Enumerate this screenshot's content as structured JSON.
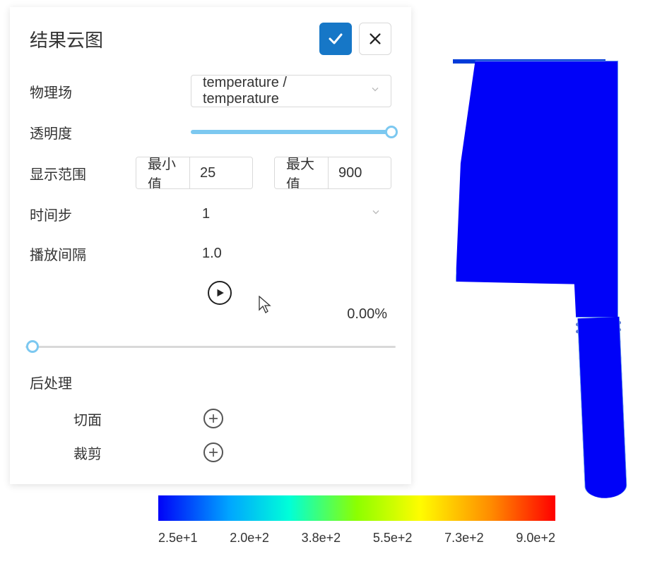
{
  "panel": {
    "title": "结果云图",
    "fields": {
      "physics_label": "物理场",
      "physics_value": "temperature / temperature",
      "opacity_label": "透明度",
      "opacity_pct": 100,
      "range_label": "显示范围",
      "min_label": "最小值",
      "min_value": "25",
      "max_label": "最大值",
      "max_value": "900",
      "timestep_label": "时间步",
      "timestep_value": "1",
      "interval_label": "播放间隔",
      "interval_value": "1.0",
      "progress_text": "0.00%",
      "progress_pct": 0
    },
    "postproc": {
      "title": "后处理",
      "slice_label": "切面",
      "clip_label": "裁剪"
    }
  },
  "legend": {
    "ticks": [
      "2.5e+1",
      "2.0e+2",
      "3.8e+2",
      "5.5e+2",
      "7.3e+2",
      "9.0e+2"
    ]
  },
  "colors": {
    "primary": "#1677c7",
    "slider": "#7cc8f0",
    "model_fill": "#0002f8"
  }
}
